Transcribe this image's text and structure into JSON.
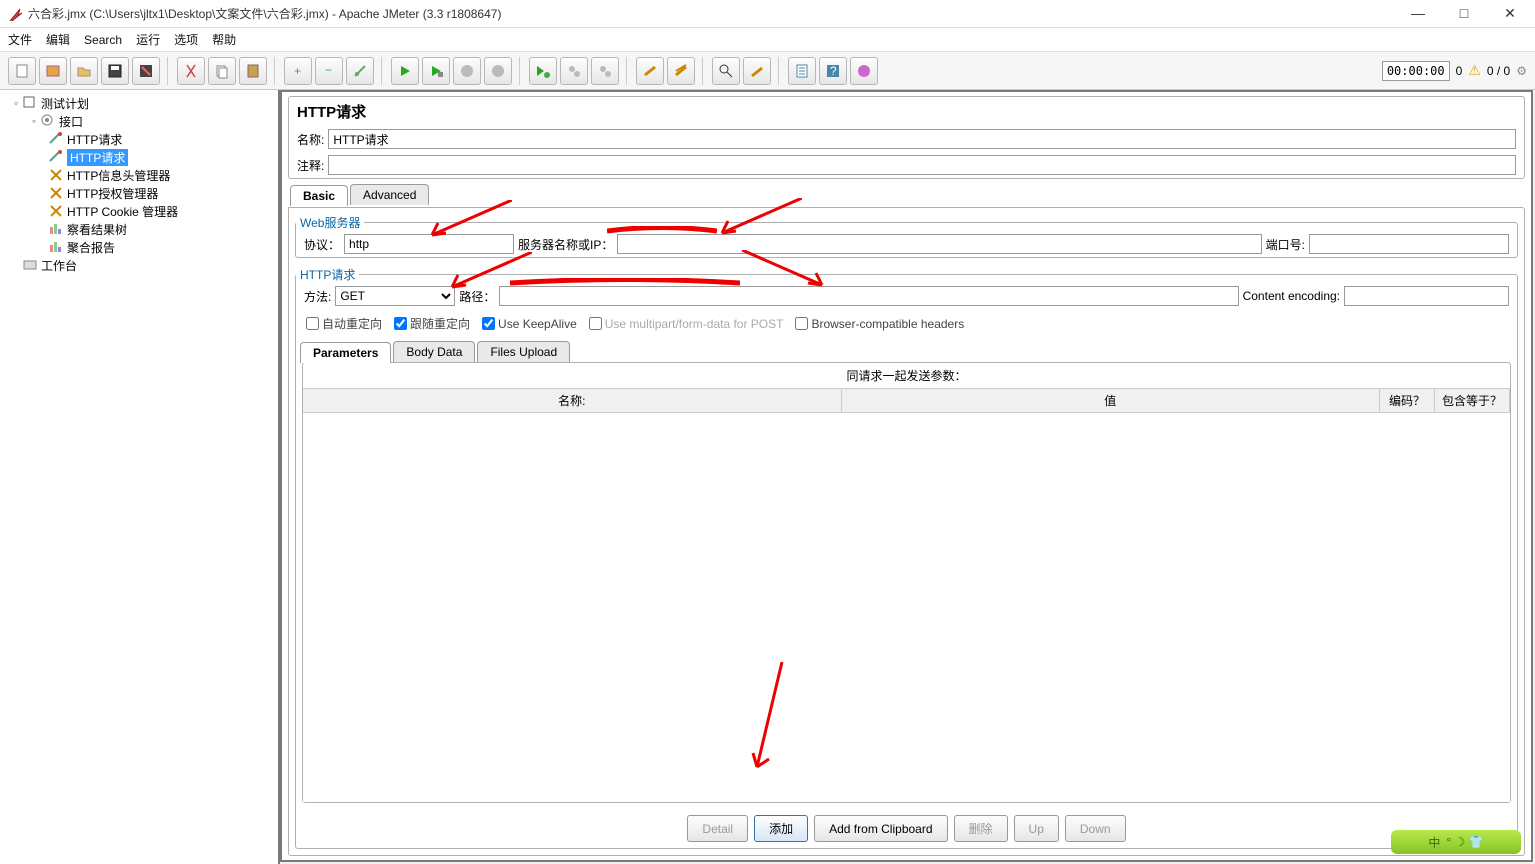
{
  "window": {
    "title": "六合彩.jmx (C:\\Users\\jltx1\\Desktop\\文案文件\\六合彩.jmx) - Apache JMeter (3.3 r1808647)"
  },
  "menu": {
    "file": "文件",
    "edit": "编辑",
    "search": "Search",
    "run": "运行",
    "options": "选项",
    "help": "帮助"
  },
  "status": {
    "timer": "00:00:00",
    "count1": "0",
    "ratio": "0 / 0"
  },
  "tree": {
    "root": "测试计划",
    "group": "接口",
    "items": [
      "HTTP请求",
      "HTTP请求",
      "HTTP信息头管理器",
      "HTTP授权管理器",
      "HTTP Cookie 管理器",
      "察看结果树",
      "聚合报告"
    ],
    "workbench": "工作台"
  },
  "panel": {
    "title": "HTTP请求",
    "name_label": "名称:",
    "name_value": "HTTP请求",
    "comment_label": "注释:",
    "comment_value": "",
    "tab_basic": "Basic",
    "tab_advanced": "Advanced",
    "web_legend": "Web服务器",
    "protocol_label": "协议：",
    "protocol_value": "http",
    "server_label": "服务器名称或IP：",
    "server_value": "",
    "port_label": "端口号:",
    "port_value": "",
    "http_legend": "HTTP请求",
    "method_label": "方法:",
    "method_value": "GET",
    "path_label": "路径：",
    "path_value": "",
    "enc_label": "Content encoding:",
    "enc_value": "",
    "cb_auto": "自动重定向",
    "cb_follow": "跟随重定向",
    "cb_keepalive": "Use KeepAlive",
    "cb_multipart": "Use multipart/form-data for POST",
    "cb_browser": "Browser-compatible headers",
    "ptab_params": "Parameters",
    "ptab_body": "Body Data",
    "ptab_files": "Files Upload",
    "params_title": "同请求一起发送参数：",
    "col_name": "名称:",
    "col_value": "值",
    "col_enc": "编码？",
    "col_inc": "包含等于？",
    "btn_detail": "Detail",
    "btn_add": "添加",
    "btn_clip": "Add from Clipboard",
    "btn_del": "删除",
    "btn_up": "Up",
    "btn_down": "Down"
  },
  "capsule": "中"
}
